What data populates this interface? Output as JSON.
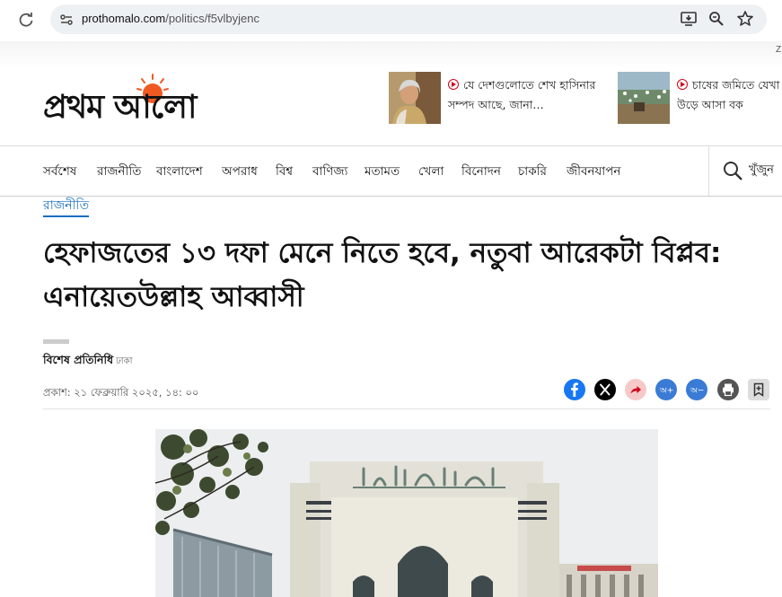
{
  "browser": {
    "url_host": "prothomalo.com",
    "url_path": "/politics/f5vlbyjenc",
    "extension_hint": "Z"
  },
  "masthead": {
    "logo_text": "প্রথম আলো",
    "news": [
      {
        "title": "যে দেশগুলোতে শেখ হাসিনার সম্পদ আছে, জানা…"
      },
      {
        "title": "চাষের জমিতে যেখা বেড়েছে উড়ে আসা বক"
      }
    ]
  },
  "nav": {
    "items": [
      "সর্বশেষ",
      "রাজনীতি",
      "বাংলাদেশ",
      "অপরাধ",
      "বিশ্ব",
      "বাণিজ্য",
      "মতামত",
      "খেলা",
      "বিনোদন",
      "চাকরি",
      "জীবনযাপন"
    ],
    "search_label": "খুঁজুন"
  },
  "article": {
    "section": "রাজনীতি",
    "headline": "হেফাজতের ১৩ দফা মেনে নিতে হবে, নতুবা আরেকটা বিপ্লব: এনায়েতউল্লাহ আব্বাসী",
    "author": "বিশেষ প্রতিনিধি",
    "location": "ঢাকা",
    "published": "প্রকাশ: ২১ ফেব্রুয়ারি ২০২৫, ১৪: ০০"
  },
  "share_icons": [
    "facebook-icon",
    "x-icon",
    "share-icon",
    "font-increase-icon",
    "font-decrease-icon",
    "print-icon",
    "bookmark-icon"
  ],
  "colors": {
    "accent": "#1a6fbf",
    "facebook": "#1877f2",
    "share_bg": "#f6c9c9",
    "sun": "#f05a22"
  }
}
